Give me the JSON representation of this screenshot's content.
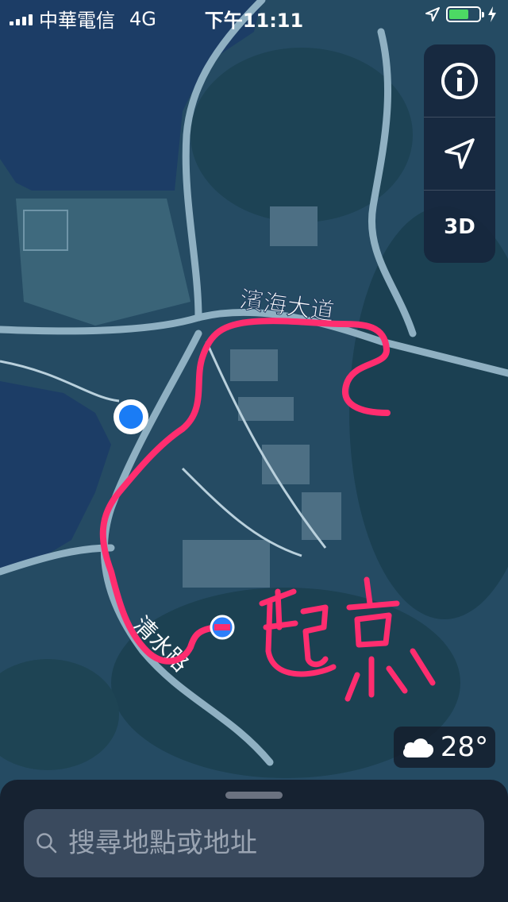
{
  "status_bar": {
    "carrier": "中華電信",
    "network": "4G",
    "time": "下午11:11",
    "battery_color": "#4cd964"
  },
  "map": {
    "road_label_top": "濱海大道",
    "road_label_bottom": "清水路",
    "annotation_text": "起點",
    "annotation_color": "#ff2d6f",
    "water_color": "#1c3d66",
    "land_color": "#254b63"
  },
  "controls": {
    "info_icon": "info-icon",
    "location_icon": "location-arrow-icon",
    "mode_3d_label": "3D"
  },
  "weather": {
    "icon": "cloud-icon",
    "temperature": "28°"
  },
  "search": {
    "icon": "search-icon",
    "placeholder": "搜尋地點或地址"
  }
}
